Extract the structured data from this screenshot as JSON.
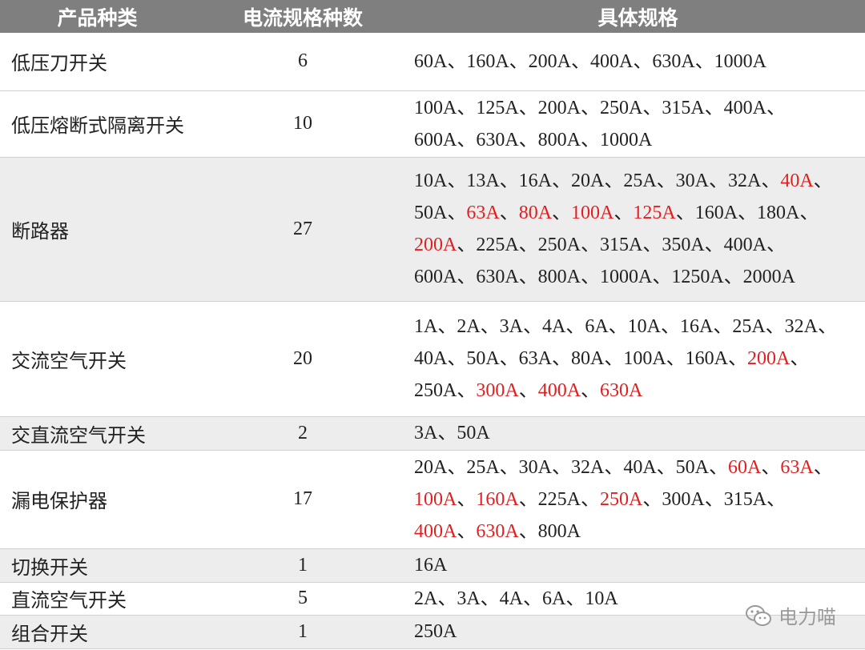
{
  "header": {
    "col1": "产品种类",
    "col2": "电流规格种数",
    "col3": "具体规格"
  },
  "rows": [
    {
      "name": "低压刀开关",
      "count": "6",
      "height": 72,
      "shaded": false,
      "lines": [
        [
          [
            "60A、160A、200A、400A、630A、1000A",
            false
          ]
        ]
      ]
    },
    {
      "name": "低压熔断式隔离开关",
      "count": "10",
      "height": 83,
      "shaded": false,
      "lines": [
        [
          [
            "100A、125A、200A、250A、315A、400A、",
            false
          ]
        ],
        [
          [
            "600A、630A、800A、1000A",
            false
          ]
        ]
      ]
    },
    {
      "name": "断路器",
      "count": "27",
      "height": 180,
      "shaded": true,
      "lines": [
        [
          [
            "10A、13A、16A、20A、25A、30A、32A、",
            false
          ],
          [
            "40A",
            true
          ],
          [
            "、",
            false
          ]
        ],
        [
          [
            "50A、",
            false
          ],
          [
            "63A",
            true
          ],
          [
            "、",
            false
          ],
          [
            "80A",
            true
          ],
          [
            "、",
            false
          ],
          [
            "100A",
            true
          ],
          [
            "、",
            false
          ],
          [
            "125A",
            true
          ],
          [
            "、160A、180A、",
            false
          ]
        ],
        [
          [
            "200A",
            true
          ],
          [
            "、225A、250A、315A、350A、400A、",
            false
          ]
        ],
        [
          [
            "600A、630A、800A、1000A、1250A、2000A",
            false
          ]
        ]
      ]
    },
    {
      "name": "交流空气开关",
      "count": "20",
      "height": 144,
      "shaded": false,
      "lines": [
        [
          [
            "1A、2A、3A、4A、6A、10A、16A、25A、32A、",
            false
          ]
        ],
        [
          [
            "40A、50A、63A、80A、100A、160A、",
            false
          ],
          [
            "200A",
            true
          ],
          [
            "、",
            false
          ]
        ],
        [
          [
            "250A、",
            false
          ],
          [
            "300A",
            true
          ],
          [
            "、",
            false
          ],
          [
            "400A",
            true
          ],
          [
            "、",
            false
          ],
          [
            "630A",
            true
          ]
        ]
      ]
    },
    {
      "name": "交直流空气开关",
      "count": "2",
      "height": 42,
      "shaded": true,
      "lines": [
        [
          [
            "3A、50A",
            false
          ]
        ]
      ]
    },
    {
      "name": "漏电保护器",
      "count": "17",
      "height": 123,
      "shaded": false,
      "lines": [
        [
          [
            "20A、25A、30A、32A、40A、50A、",
            false
          ],
          [
            "60A",
            true
          ],
          [
            "、",
            false
          ],
          [
            "63A",
            true
          ],
          [
            "、",
            false
          ]
        ],
        [
          [
            "100A",
            true
          ],
          [
            "、",
            false
          ],
          [
            "160A",
            true
          ],
          [
            "、225A、",
            false
          ],
          [
            "250A",
            true
          ],
          [
            "、300A、315A、",
            false
          ]
        ],
        [
          [
            "400A",
            true
          ],
          [
            "、",
            false
          ],
          [
            "630A",
            true
          ],
          [
            "、800A",
            false
          ]
        ]
      ]
    },
    {
      "name": "切换开关",
      "count": "1",
      "height": 42,
      "shaded": true,
      "lines": [
        [
          [
            "16A",
            false
          ]
        ]
      ]
    },
    {
      "name": "直流空气开关",
      "count": "5",
      "height": 41,
      "shaded": false,
      "lines": [
        [
          [
            "2A、3A、4A、6A、10A",
            false
          ]
        ]
      ]
    },
    {
      "name": "组合开关",
      "count": "1",
      "height": 42,
      "shaded": true,
      "lines": [
        [
          [
            "250A",
            false
          ]
        ]
      ]
    }
  ],
  "colors": {
    "header_bg": "#7f7f7f",
    "highlight": "#e02020",
    "shaded_row": "#ededed"
  },
  "watermark": {
    "text": "电力喵",
    "icon": "wechat-icon"
  }
}
